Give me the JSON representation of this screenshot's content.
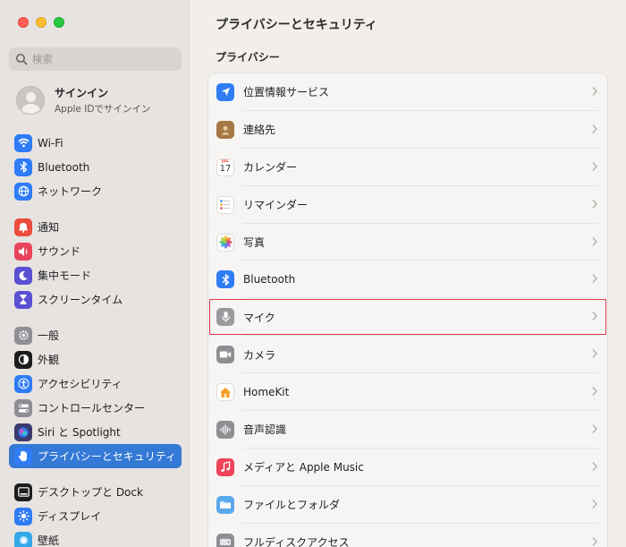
{
  "window": {
    "title": "プライバシーとセキュリティ"
  },
  "search": {
    "placeholder": "検索"
  },
  "account": {
    "title": "サインイン",
    "subtitle": "Apple IDでサインイン"
  },
  "sidebar": {
    "items": [
      {
        "label": "Wi-Fi",
        "icon": "wifi-icon",
        "color": "#2f7cf6"
      },
      {
        "label": "Bluetooth",
        "icon": "bluetooth-icon",
        "color": "#2f7cf6"
      },
      {
        "label": "ネットワーク",
        "icon": "globe-icon",
        "color": "#2f7cf6"
      },
      {
        "label": "通知",
        "icon": "bell-icon",
        "color": "#eb4d3d"
      },
      {
        "label": "サウンド",
        "icon": "speaker-icon",
        "color": "#e8455c"
      },
      {
        "label": "集中モード",
        "icon": "moon-icon",
        "color": "#5b4fd3"
      },
      {
        "label": "スクリーンタイム",
        "icon": "hourglass-icon",
        "color": "#5b4fd3"
      },
      {
        "label": "一般",
        "icon": "gear-icon",
        "color": "#8e8e93"
      },
      {
        "label": "外観",
        "icon": "appearance-icon",
        "color": "#1d1d1f"
      },
      {
        "label": "アクセシビリティ",
        "icon": "accessibility-icon",
        "color": "#2f7cf6"
      },
      {
        "label": "コントロールセンター",
        "icon": "toggles-icon",
        "color": "#8e8e93"
      },
      {
        "label": "Siri と Spotlight",
        "icon": "siri-icon",
        "color": "#3a3a6e"
      },
      {
        "label": "プライバシーとセキュリティ",
        "icon": "hand-icon",
        "color": "#2f7cf6"
      },
      {
        "label": "デスクトップと Dock",
        "icon": "dock-icon",
        "color": "#1d1d1f"
      },
      {
        "label": "ディスプレイ",
        "icon": "sun-icon",
        "color": "#2f7cf6"
      },
      {
        "label": "壁紙",
        "icon": "wallpaper-icon",
        "color": "#33a7e8"
      }
    ]
  },
  "main": {
    "section": "プライバシー",
    "rows": [
      {
        "label": "位置情報サービス",
        "icon": "location-icon",
        "color": "#2f7cf6"
      },
      {
        "label": "連絡先",
        "icon": "contacts-icon",
        "color": "#a57845"
      },
      {
        "label": "カレンダー",
        "icon": "calendar-icon",
        "color": "#ffffff",
        "calendar_month": "JUL",
        "calendar_day": "17"
      },
      {
        "label": "リマインダー",
        "icon": "reminders-icon",
        "color": "#ffffff"
      },
      {
        "label": "写真",
        "icon": "photos-icon",
        "color": "#ffffff"
      },
      {
        "label": "Bluetooth",
        "icon": "bluetooth-icon",
        "color": "#2f7cf6"
      },
      {
        "label": "マイク",
        "icon": "microphone-icon",
        "color": "#9a9a9e"
      },
      {
        "label": "カメラ",
        "icon": "camera-icon",
        "color": "#8e8e93"
      },
      {
        "label": "HomeKit",
        "icon": "home-icon",
        "color": "#ffffff"
      },
      {
        "label": "音声認識",
        "icon": "waveform-icon",
        "color": "#8e8e93"
      },
      {
        "label": "メディアと Apple Music",
        "icon": "music-icon",
        "color": "#f0435a"
      },
      {
        "label": "ファイルとフォルダ",
        "icon": "folder-icon",
        "color": "#5aa9ea"
      },
      {
        "label": "フルディスクアクセス",
        "icon": "disk-icon",
        "color": "#8e8e93"
      }
    ]
  }
}
